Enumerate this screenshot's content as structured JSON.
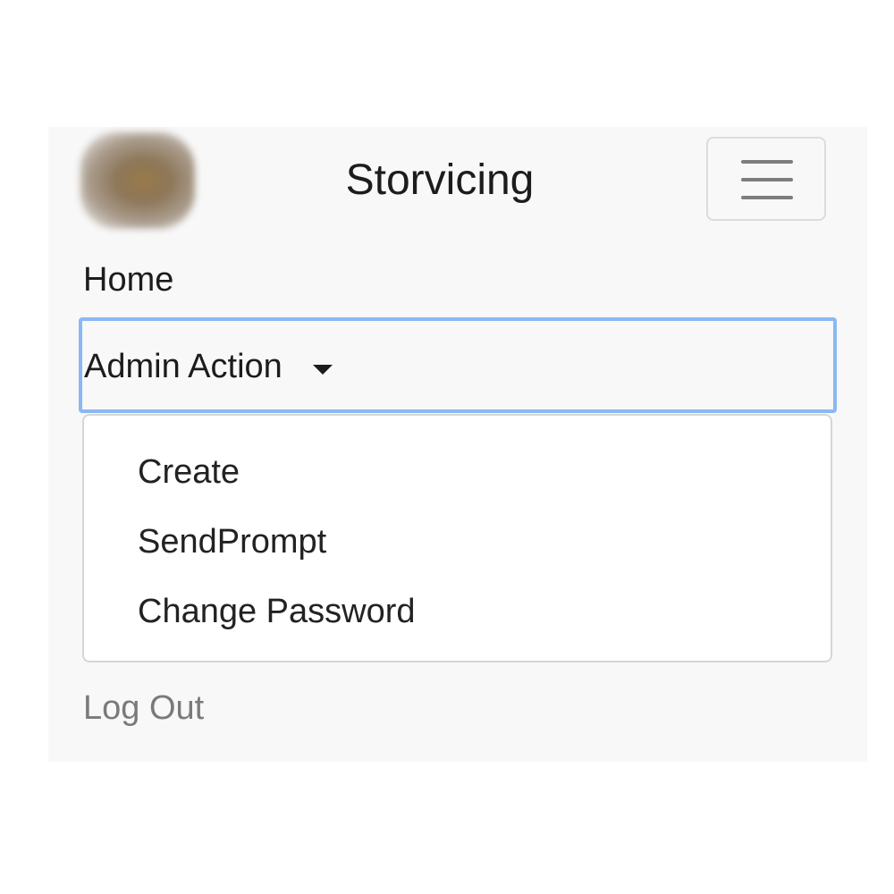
{
  "navbar": {
    "brand": "Storvicing",
    "logo_icon": "blurred-avatar-logo",
    "toggler_icon": "hamburger-menu-icon",
    "home_label": "Home",
    "dropdown": {
      "label": "Admin Action",
      "caret_icon": "caret-down-icon",
      "focus_color": "#8ab8f2",
      "items": [
        {
          "label": "Create"
        },
        {
          "label": "SendPrompt"
        },
        {
          "label": "Change Password"
        }
      ]
    },
    "logout_label": "Log Out"
  }
}
